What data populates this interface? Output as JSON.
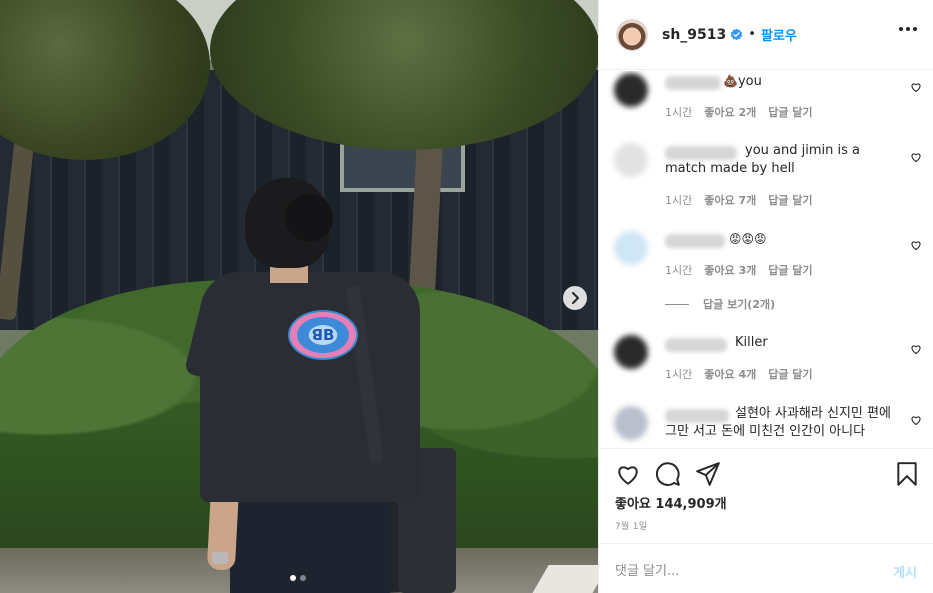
{
  "post": {
    "username": "sh_9513",
    "separator": "•",
    "follow_label": "팔로우",
    "likes_text": "좋아요 144,909개",
    "date_text": "7월 1일",
    "carousel": {
      "slides": 2,
      "current": 1
    }
  },
  "comments": [
    {
      "text": "you",
      "emoji": "💩",
      "time": "1시간",
      "likes": "좋아요 2개",
      "reply": "답글 달기"
    },
    {
      "text": "you and jimin is a match made by hell",
      "time": "1시간",
      "likes": "좋아요 7개",
      "reply": "답글 달기"
    },
    {
      "text": "",
      "emoji": "😡😡😡",
      "time": "1시간",
      "likes": "좋아요 3개",
      "reply": "답글 달기",
      "view_replies": "답글 보기(2개)"
    },
    {
      "text": "Killer",
      "time": "1시간",
      "likes": "좋아요 4개",
      "reply": "답글 달기"
    },
    {
      "text": "설현아 사과해라 신지민 편에 그만 서고 돈에 미친건 인간이 아니다"
    }
  ],
  "composer": {
    "placeholder": "댓글 달기...",
    "post_label": "게시"
  },
  "icons": {
    "verified": "verified-badge-icon",
    "more": "more-options-icon",
    "heart": "heart-icon",
    "comment": "comment-icon",
    "share": "share-icon",
    "save": "bookmark-icon",
    "next": "chevron-right-icon"
  },
  "colors": {
    "accent": "#0095f6",
    "verified": "#3897f0",
    "muted": "#8e8e8e",
    "post_disabled": "#b2dffc"
  }
}
